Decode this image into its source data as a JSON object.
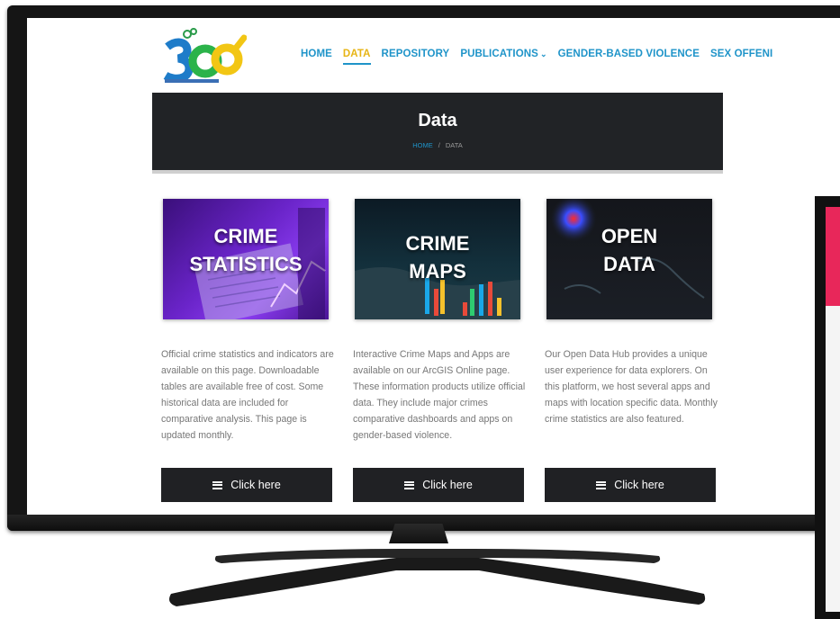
{
  "nav": {
    "items": [
      {
        "label": "HOME"
      },
      {
        "label": "DATA"
      },
      {
        "label": "REPOSITORY"
      },
      {
        "label": "PUBLICATIONS"
      },
      {
        "label": "GENDER-BASED VIOLENCE"
      },
      {
        "label": "SEX OFFENI"
      }
    ],
    "active": "DATA"
  },
  "banner": {
    "title": "Data",
    "breadcrumb_home": "HOME",
    "breadcrumb_sep": "/",
    "breadcrumb_current": "DATA"
  },
  "cards": [
    {
      "image_title_line1": "CRIME",
      "image_title_line2": "STATISTICS",
      "description": "Official crime statistics and indicators are available on this page. Downloadable tables are available free of cost. Some historical data are included for comparative analysis. This page is updated monthly.",
      "button_label": "Click here"
    },
    {
      "image_title_line1": "CRIME",
      "image_title_line2": "MAPS",
      "description": "Interactive Crime Maps and Apps are available on our ArcGIS Online page. These information products utilize official data. They include major crimes comparative dashboards and apps on gender-based violence.",
      "button_label": "Click here"
    },
    {
      "image_title_line1": "OPEN",
      "image_title_line2": "DATA",
      "description": "Our Open Data Hub provides a unique user experience for data explorers. On this platform, we host several apps and maps with location specific data. Monthly crime statistics are also featured.",
      "button_label": "Click here"
    }
  ],
  "colors": {
    "accent": "#1f94c9",
    "active_nav": "#e7b414",
    "banner_bg": "#212326",
    "button_bg": "#202124"
  },
  "icons": [
    "logo-icon",
    "chevron-down-icon",
    "menu-icon"
  ]
}
